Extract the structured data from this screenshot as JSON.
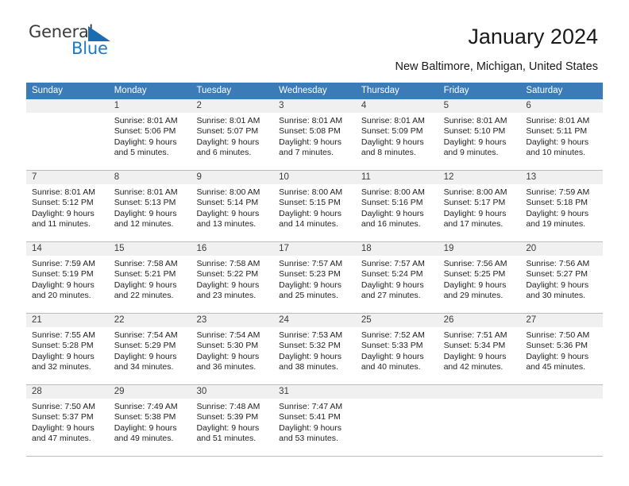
{
  "brand": {
    "name_part1": "General",
    "name_part2": "Blue",
    "triangle_color": "#1b6cb0",
    "blue_color": "#1b7bc4"
  },
  "header": {
    "title": "January 2024",
    "subtitle": "New Baltimore, Michigan, United States"
  },
  "theme": {
    "header_row_bg": "#3b7cb8",
    "header_row_text": "#ffffff",
    "daynum_band_bg": "#f0f0f0",
    "row_divider": "#bcbcbc"
  },
  "weekdays": [
    "Sunday",
    "Monday",
    "Tuesday",
    "Wednesday",
    "Thursday",
    "Friday",
    "Saturday"
  ],
  "weeks": [
    {
      "days": [
        {
          "day": "",
          "lines": [
            "",
            "",
            "",
            ""
          ]
        },
        {
          "day": "1",
          "lines": [
            "Sunrise: 8:01 AM",
            "Sunset: 5:06 PM",
            "Daylight: 9 hours",
            "and 5 minutes."
          ]
        },
        {
          "day": "2",
          "lines": [
            "Sunrise: 8:01 AM",
            "Sunset: 5:07 PM",
            "Daylight: 9 hours",
            "and 6 minutes."
          ]
        },
        {
          "day": "3",
          "lines": [
            "Sunrise: 8:01 AM",
            "Sunset: 5:08 PM",
            "Daylight: 9 hours",
            "and 7 minutes."
          ]
        },
        {
          "day": "4",
          "lines": [
            "Sunrise: 8:01 AM",
            "Sunset: 5:09 PM",
            "Daylight: 9 hours",
            "and 8 minutes."
          ]
        },
        {
          "day": "5",
          "lines": [
            "Sunrise: 8:01 AM",
            "Sunset: 5:10 PM",
            "Daylight: 9 hours",
            "and 9 minutes."
          ]
        },
        {
          "day": "6",
          "lines": [
            "Sunrise: 8:01 AM",
            "Sunset: 5:11 PM",
            "Daylight: 9 hours",
            "and 10 minutes."
          ]
        }
      ]
    },
    {
      "days": [
        {
          "day": "7",
          "lines": [
            "Sunrise: 8:01 AM",
            "Sunset: 5:12 PM",
            "Daylight: 9 hours",
            "and 11 minutes."
          ]
        },
        {
          "day": "8",
          "lines": [
            "Sunrise: 8:01 AM",
            "Sunset: 5:13 PM",
            "Daylight: 9 hours",
            "and 12 minutes."
          ]
        },
        {
          "day": "9",
          "lines": [
            "Sunrise: 8:00 AM",
            "Sunset: 5:14 PM",
            "Daylight: 9 hours",
            "and 13 minutes."
          ]
        },
        {
          "day": "10",
          "lines": [
            "Sunrise: 8:00 AM",
            "Sunset: 5:15 PM",
            "Daylight: 9 hours",
            "and 14 minutes."
          ]
        },
        {
          "day": "11",
          "lines": [
            "Sunrise: 8:00 AM",
            "Sunset: 5:16 PM",
            "Daylight: 9 hours",
            "and 16 minutes."
          ]
        },
        {
          "day": "12",
          "lines": [
            "Sunrise: 8:00 AM",
            "Sunset: 5:17 PM",
            "Daylight: 9 hours",
            "and 17 minutes."
          ]
        },
        {
          "day": "13",
          "lines": [
            "Sunrise: 7:59 AM",
            "Sunset: 5:18 PM",
            "Daylight: 9 hours",
            "and 19 minutes."
          ]
        }
      ]
    },
    {
      "days": [
        {
          "day": "14",
          "lines": [
            "Sunrise: 7:59 AM",
            "Sunset: 5:19 PM",
            "Daylight: 9 hours",
            "and 20 minutes."
          ]
        },
        {
          "day": "15",
          "lines": [
            "Sunrise: 7:58 AM",
            "Sunset: 5:21 PM",
            "Daylight: 9 hours",
            "and 22 minutes."
          ]
        },
        {
          "day": "16",
          "lines": [
            "Sunrise: 7:58 AM",
            "Sunset: 5:22 PM",
            "Daylight: 9 hours",
            "and 23 minutes."
          ]
        },
        {
          "day": "17",
          "lines": [
            "Sunrise: 7:57 AM",
            "Sunset: 5:23 PM",
            "Daylight: 9 hours",
            "and 25 minutes."
          ]
        },
        {
          "day": "18",
          "lines": [
            "Sunrise: 7:57 AM",
            "Sunset: 5:24 PM",
            "Daylight: 9 hours",
            "and 27 minutes."
          ]
        },
        {
          "day": "19",
          "lines": [
            "Sunrise: 7:56 AM",
            "Sunset: 5:25 PM",
            "Daylight: 9 hours",
            "and 29 minutes."
          ]
        },
        {
          "day": "20",
          "lines": [
            "Sunrise: 7:56 AM",
            "Sunset: 5:27 PM",
            "Daylight: 9 hours",
            "and 30 minutes."
          ]
        }
      ]
    },
    {
      "days": [
        {
          "day": "21",
          "lines": [
            "Sunrise: 7:55 AM",
            "Sunset: 5:28 PM",
            "Daylight: 9 hours",
            "and 32 minutes."
          ]
        },
        {
          "day": "22",
          "lines": [
            "Sunrise: 7:54 AM",
            "Sunset: 5:29 PM",
            "Daylight: 9 hours",
            "and 34 minutes."
          ]
        },
        {
          "day": "23",
          "lines": [
            "Sunrise: 7:54 AM",
            "Sunset: 5:30 PM",
            "Daylight: 9 hours",
            "and 36 minutes."
          ]
        },
        {
          "day": "24",
          "lines": [
            "Sunrise: 7:53 AM",
            "Sunset: 5:32 PM",
            "Daylight: 9 hours",
            "and 38 minutes."
          ]
        },
        {
          "day": "25",
          "lines": [
            "Sunrise: 7:52 AM",
            "Sunset: 5:33 PM",
            "Daylight: 9 hours",
            "and 40 minutes."
          ]
        },
        {
          "day": "26",
          "lines": [
            "Sunrise: 7:51 AM",
            "Sunset: 5:34 PM",
            "Daylight: 9 hours",
            "and 42 minutes."
          ]
        },
        {
          "day": "27",
          "lines": [
            "Sunrise: 7:50 AM",
            "Sunset: 5:36 PM",
            "Daylight: 9 hours",
            "and 45 minutes."
          ]
        }
      ]
    },
    {
      "days": [
        {
          "day": "28",
          "lines": [
            "Sunrise: 7:50 AM",
            "Sunset: 5:37 PM",
            "Daylight: 9 hours",
            "and 47 minutes."
          ]
        },
        {
          "day": "29",
          "lines": [
            "Sunrise: 7:49 AM",
            "Sunset: 5:38 PM",
            "Daylight: 9 hours",
            "and 49 minutes."
          ]
        },
        {
          "day": "30",
          "lines": [
            "Sunrise: 7:48 AM",
            "Sunset: 5:39 PM",
            "Daylight: 9 hours",
            "and 51 minutes."
          ]
        },
        {
          "day": "31",
          "lines": [
            "Sunrise: 7:47 AM",
            "Sunset: 5:41 PM",
            "Daylight: 9 hours",
            "and 53 minutes."
          ]
        },
        {
          "day": "",
          "lines": [
            "",
            "",
            "",
            ""
          ]
        },
        {
          "day": "",
          "lines": [
            "",
            "",
            "",
            ""
          ]
        },
        {
          "day": "",
          "lines": [
            "",
            "",
            "",
            ""
          ]
        }
      ]
    }
  ]
}
